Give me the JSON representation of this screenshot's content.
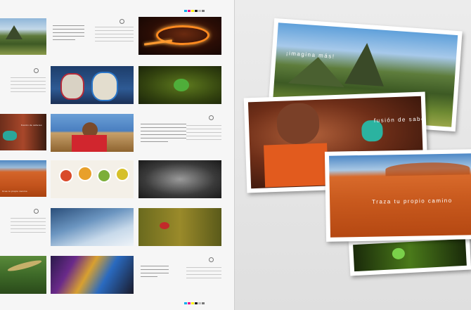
{
  "sheet": {
    "thumbnail_captions": {
      "dunes": "Crea tu propio camino",
      "fusion": "Fusión de saberes",
      "imagina": "imagina más"
    },
    "cmyk_colors": [
      "#00aeef",
      "#ec008c",
      "#fff200",
      "#231f20",
      "#bcbcbc",
      "#7a7a7a"
    ]
  },
  "cards": {
    "machu_picchu": {
      "caption": "¡imagina más!"
    },
    "artisan": {
      "caption": "fusión de saberes"
    },
    "dunes": {
      "caption": "Traza tu propio camino"
    }
  },
  "colors": {
    "paper": "#f6f6f6",
    "background": "#e4e4e4",
    "card_border": "#ffffff"
  }
}
